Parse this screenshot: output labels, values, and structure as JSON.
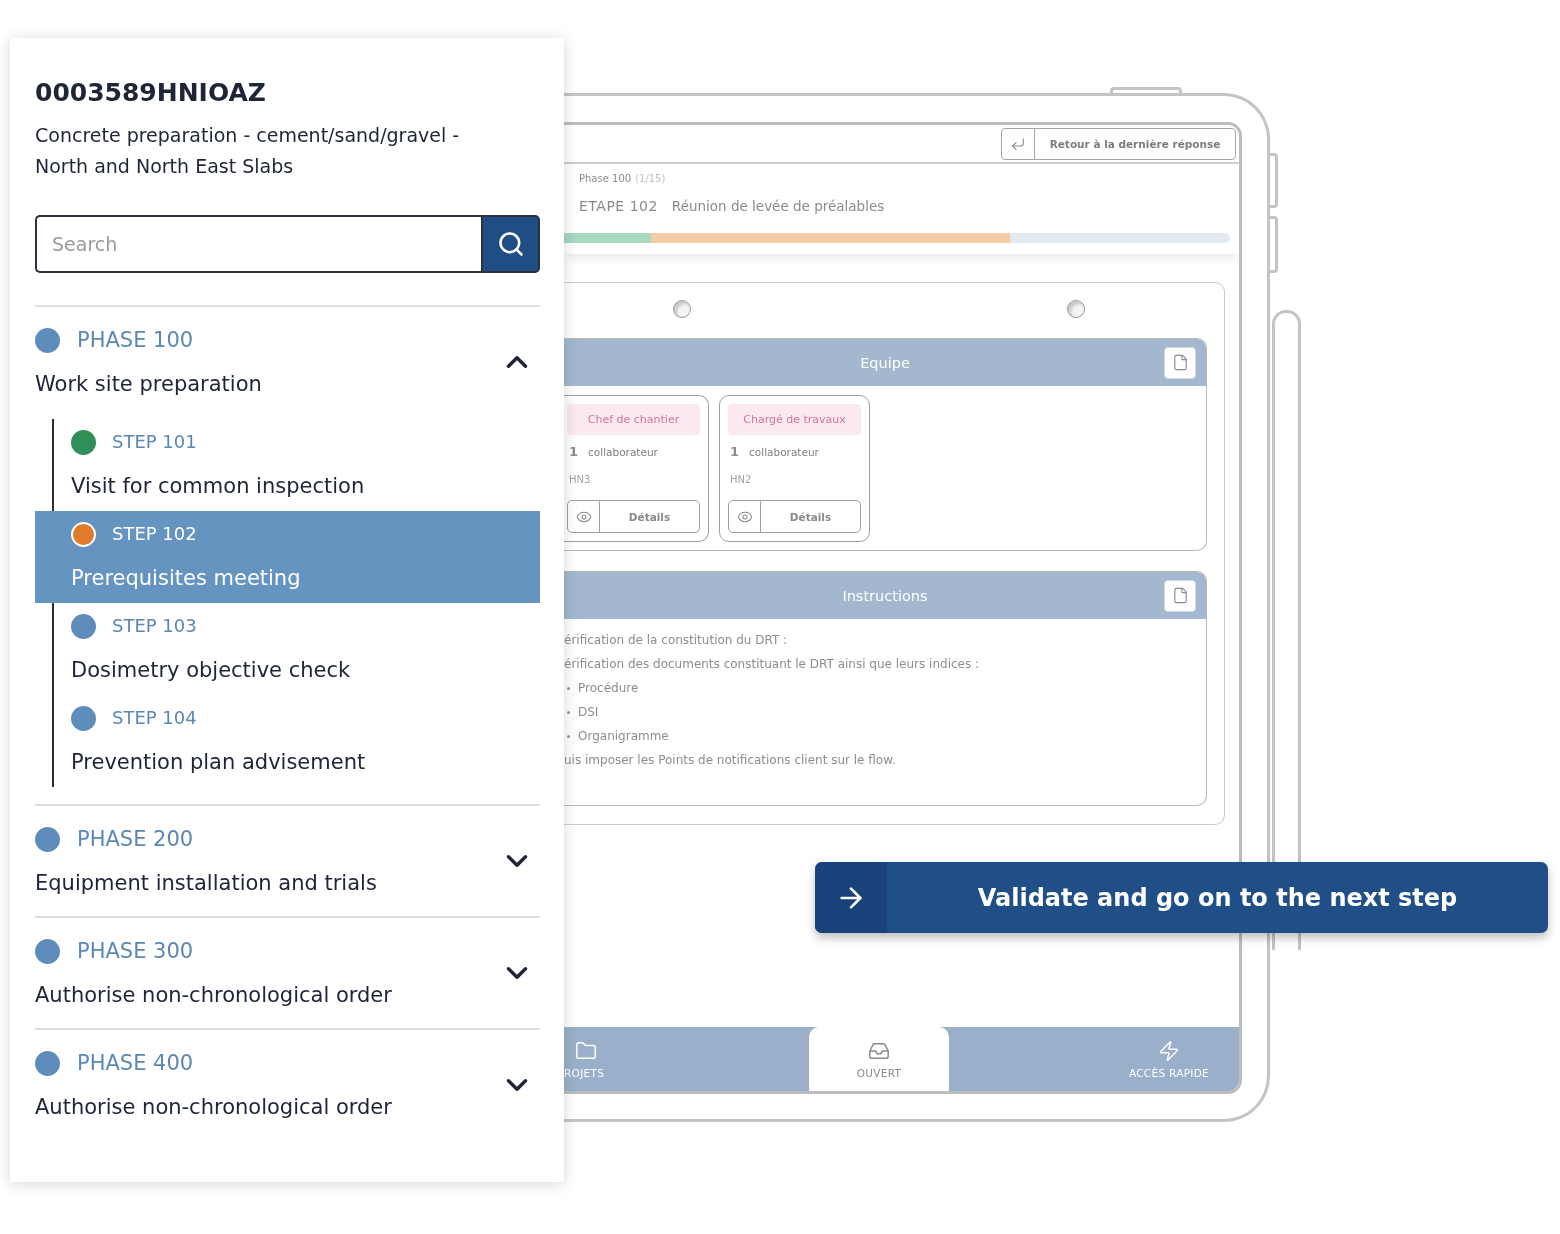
{
  "sidebar": {
    "code": "0003589HNIOAZ",
    "description": "Concrete preparation - cement/sand/gravel - North and North East Slabs",
    "search": {
      "placeholder": "Search"
    },
    "phases": [
      {
        "label": "PHASE 100",
        "title": "Work site preparation",
        "color": "#5f8dbb",
        "expanded": true,
        "steps": [
          {
            "label": "STEP 101",
            "title": "Visit for common inspection",
            "color": "#2f8f57",
            "selected": false
          },
          {
            "label": "STEP 102",
            "title": "Prerequisites meeting",
            "color": "#e07b2c",
            "selected": true
          },
          {
            "label": "STEP 103",
            "title": "Dosimetry objective check",
            "color": "#5f8dbb",
            "selected": false
          },
          {
            "label": "STEP 104",
            "title": "Prevention plan advisement",
            "color": "#5f8dbb",
            "selected": false
          }
        ]
      },
      {
        "label": "PHASE 200",
        "title": "Equipment installation and trials",
        "color": "#5f8dbb",
        "expanded": false
      },
      {
        "label": "PHASE 300",
        "title": "Authorise non-chronological order",
        "color": "#5f8dbb",
        "expanded": false
      },
      {
        "label": "PHASE 400",
        "title": "Authorise non-chronological order",
        "color": "#5f8dbb",
        "expanded": false
      }
    ]
  },
  "tablet": {
    "back_button": "Retour à la dernière réponse",
    "phase": "Phase 100",
    "phase_count": "(1/15)",
    "step_code": "ETAPE 102",
    "step_title": "Réunion de levée de préalables",
    "progress": [
      {
        "kind": "done",
        "level": 0.13
      },
      {
        "kind": "current",
        "level": 0.67
      }
    ],
    "options": [
      {
        "selected": false
      },
      {
        "selected": false
      }
    ],
    "team": {
      "title": "Equipe",
      "members": [
        {
          "role": "Chef de chantier",
          "count": "1",
          "unit": "collaborateur",
          "code": "HN3",
          "button": "Détails"
        },
        {
          "role": "Chargé de travaux",
          "count": "1",
          "unit": "collaborateur",
          "code": "HN2",
          "button": "Détails"
        }
      ]
    },
    "instructions": {
      "title": "Instructions",
      "lines": [
        {
          "kind": "text",
          "text": "érification de la constitution du DRT :"
        },
        {
          "kind": "text",
          "text": "érification des documents constituant le DRT ainsi que leurs indices :"
        },
        {
          "kind": "bullet",
          "text": "Procédure"
        },
        {
          "kind": "bullet",
          "text": "DSI"
        },
        {
          "kind": "bullet",
          "text": "Organigramme"
        },
        {
          "kind": "text",
          "text": "uis imposer les Points de notifications client sur le flow."
        }
      ]
    },
    "nav": [
      {
        "label": "ROJETS",
        "selected": false
      },
      {
        "label": "OUVERT",
        "selected": true
      },
      {
        "label": "ACCÈS RAPIDE",
        "selected": false
      }
    ]
  },
  "validate_button": "Validate and go on to the next step"
}
